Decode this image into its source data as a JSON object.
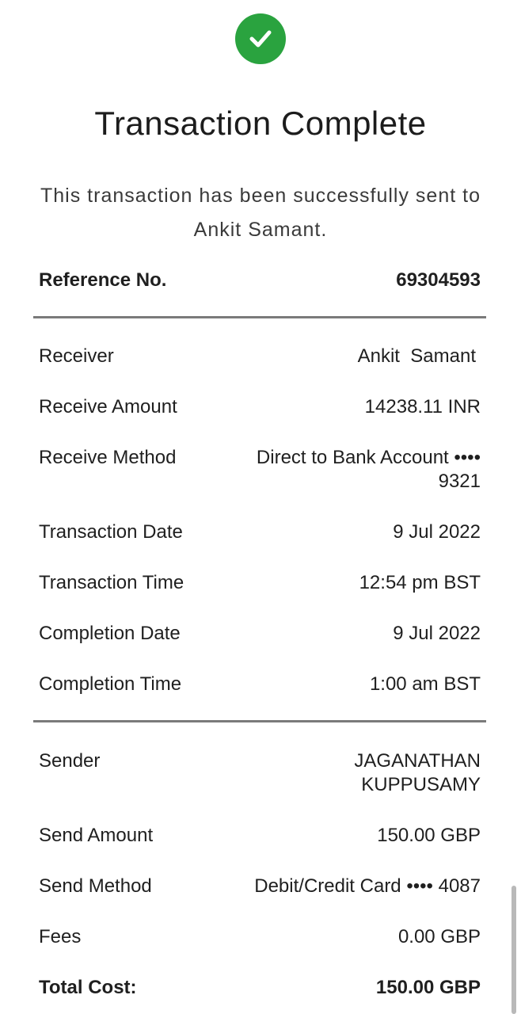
{
  "status_icon": "check-circle-icon",
  "accent_color": "#2aa33f",
  "title": "Transaction Complete",
  "subtitle": "This transaction has been successfully sent to Ankit Samant.",
  "reference": {
    "label": "Reference No.",
    "value": "69304593"
  },
  "receiver_details": [
    {
      "label": "Receiver",
      "value": "Ankit  Samant"
    },
    {
      "label": "Receive Amount",
      "value": "14238.11 INR"
    },
    {
      "label": "Receive Method",
      "value": "Direct to Bank Account •••• 9321"
    },
    {
      "label": "Transaction Date",
      "value": "9 Jul 2022"
    },
    {
      "label": "Transaction Time",
      "value": "12:54 pm BST"
    },
    {
      "label": "Completion Date",
      "value": "9 Jul 2022"
    },
    {
      "label": "Completion Time",
      "value": "1:00 am BST"
    }
  ],
  "sender_details": [
    {
      "label": "Sender",
      "value": "JAGANATHAN KUPPUSAMY"
    },
    {
      "label": "Send Amount",
      "value": "150.00 GBP"
    },
    {
      "label": "Send Method",
      "value": "Debit/Credit Card •••• 4087"
    },
    {
      "label": "Fees",
      "value": "0.00 GBP"
    }
  ],
  "total": {
    "label": "Total Cost:",
    "value": "150.00 GBP"
  }
}
